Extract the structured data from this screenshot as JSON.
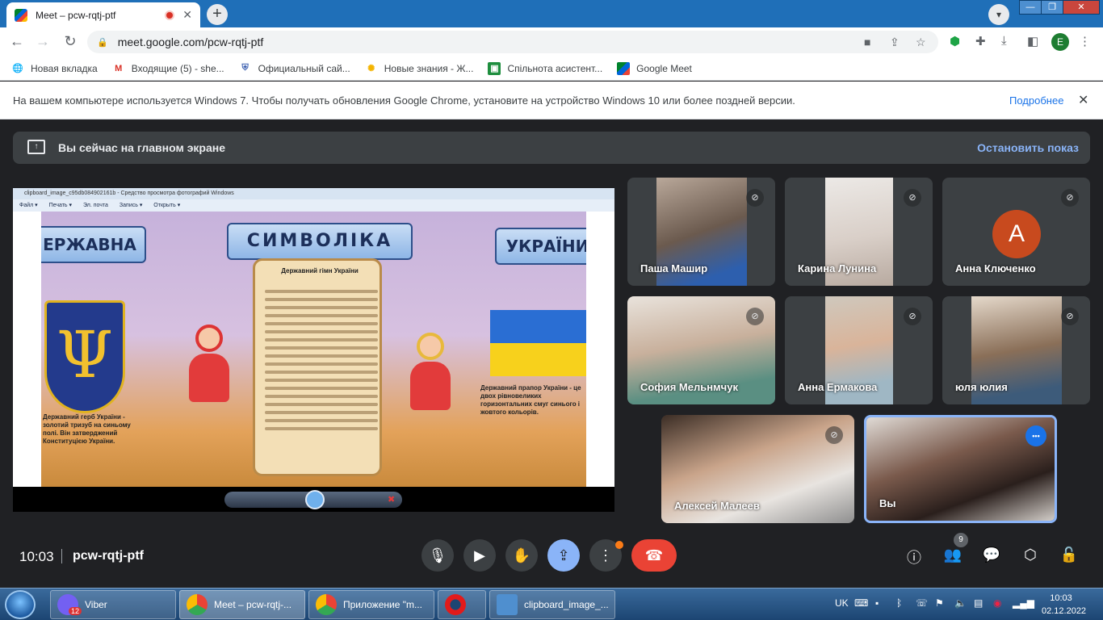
{
  "browser": {
    "tab_title": "Meet – pcw-rqtj-ptf",
    "close_glyph": "✕",
    "new_tab_glyph": "+",
    "url": "meet.google.com/pcw-rqtj-ptf",
    "profile_initial": "E",
    "window_minimize": "—",
    "window_maximize": "❐",
    "window_close": "✕"
  },
  "bookmarks": [
    {
      "label": "Новая вкладка",
      "icon": "globe-icon"
    },
    {
      "label": "Входящие (5) - she...",
      "icon": "gmail-icon"
    },
    {
      "label": "Официальный сай...",
      "icon": "shield-icon"
    },
    {
      "label": "Новые знания - Ж...",
      "icon": "sun-icon"
    },
    {
      "label": "Спільнота асистент...",
      "icon": "classroom-icon"
    },
    {
      "label": "Google Meet",
      "icon": "meet-icon"
    }
  ],
  "infobar": {
    "message": "На вашем компьютере используется Windows 7. Чтобы получать обновления Google Chrome, установите на устройство Windows 10 или более поздней версии.",
    "link": "Подробнее",
    "close": "✕"
  },
  "meet": {
    "presenting_text": "Вы сейчас на главном экране",
    "stop_presenting": "Остановить показ",
    "shared_screen": {
      "window_title": "clipboard_image_c95db084902161b - Средство просмотра фотографий Windows",
      "menu": [
        "Файл ▾",
        "Печать ▾",
        "Эл. почта",
        "Запись ▾",
        "Открыть ▾"
      ],
      "poster_title": "СИМВОЛІКА",
      "poster_left": "ЕРЖАВНА",
      "poster_right": "УКРАЇНИ",
      "anthem_title": "Державний гімн України",
      "left_caption": "Державний герб України - золотий тризуб на синьому полі. Він затверджений Конституцією України.",
      "right_caption": "Державний прапор України - це двох рівновеликих горизонтальних смуг синього і жовтого кольорів."
    },
    "participants": [
      {
        "name": "Паша Машир",
        "muted": true
      },
      {
        "name": "Карина Лунина",
        "muted": true
      },
      {
        "name": "Анна Ключенко",
        "muted": true,
        "avatar": "A",
        "avatar_color": "#c84a1e"
      },
      {
        "name": "София Мельнмчук",
        "muted": true
      },
      {
        "name": "Анна Ермакова",
        "muted": true
      },
      {
        "name": "юля юлия",
        "muted": true
      },
      {
        "name": "Алексей Малеев",
        "muted": true
      },
      {
        "name": "Вы",
        "muted": false
      }
    ],
    "more_glyph": "•••",
    "clock": "10:03",
    "meeting_code": "pcw-rqtj-ptf",
    "people_count": "9"
  },
  "taskbar": {
    "items": [
      {
        "label": "Viber",
        "badge": "12",
        "color": "#7360f2"
      },
      {
        "label": "Meet – pcw-rqtj-...",
        "color": "#f2b705"
      },
      {
        "label": "Приложение \"m...",
        "color": "#f2b705"
      },
      {
        "label": "",
        "color": "#e21b1b"
      },
      {
        "label": "clipboard_image_...",
        "color": "#4f8fcf"
      }
    ],
    "lang": "UK",
    "time": "10:03",
    "date": "02.12.2022"
  }
}
